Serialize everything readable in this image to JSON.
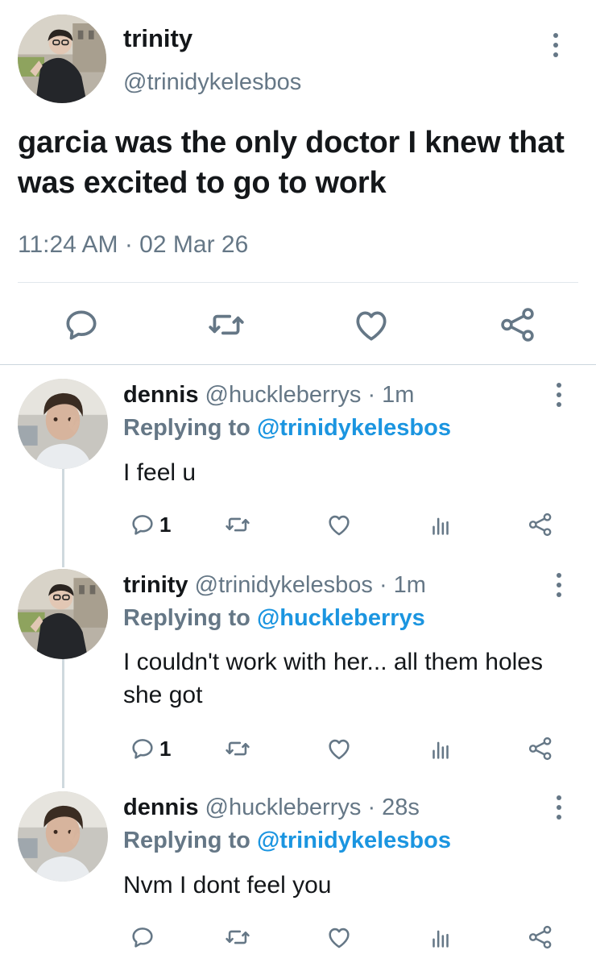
{
  "main_tweet": {
    "name": "trinity",
    "handle": "@trinidykelesbos",
    "text": "garcia was the only doctor I knew that was excited to go to work",
    "timestamp": "11:24 AM · 02 Mar 26",
    "actions": [
      "reply-icon",
      "retweet-icon",
      "like-icon",
      "share-icon"
    ]
  },
  "replies": [
    {
      "name": "dennis",
      "handle": "@huckleberrys",
      "time": "· 1m",
      "replying_label": "Replying to",
      "replying_to": "@trinidykelesbos",
      "text": "I feel u",
      "reply_count": "1"
    },
    {
      "name": "trinity",
      "handle": "@trinidykelesbos",
      "time": "· 1m",
      "replying_label": "Replying to",
      "replying_to": "@huckleberrys",
      "text": "I couldn't work with her... all them holes she got",
      "reply_count": "1"
    },
    {
      "name": "dennis",
      "handle": "@huckleberrys",
      "time": "· 28s",
      "replying_label": "Replying to",
      "replying_to": "@trinidykelesbos",
      "text": "Nvm I dont feel you",
      "reply_count": ""
    }
  ],
  "colors": {
    "text": "#14171a",
    "muted": "#657786",
    "link": "#1b95e0",
    "divider": "#e1e8ed"
  }
}
